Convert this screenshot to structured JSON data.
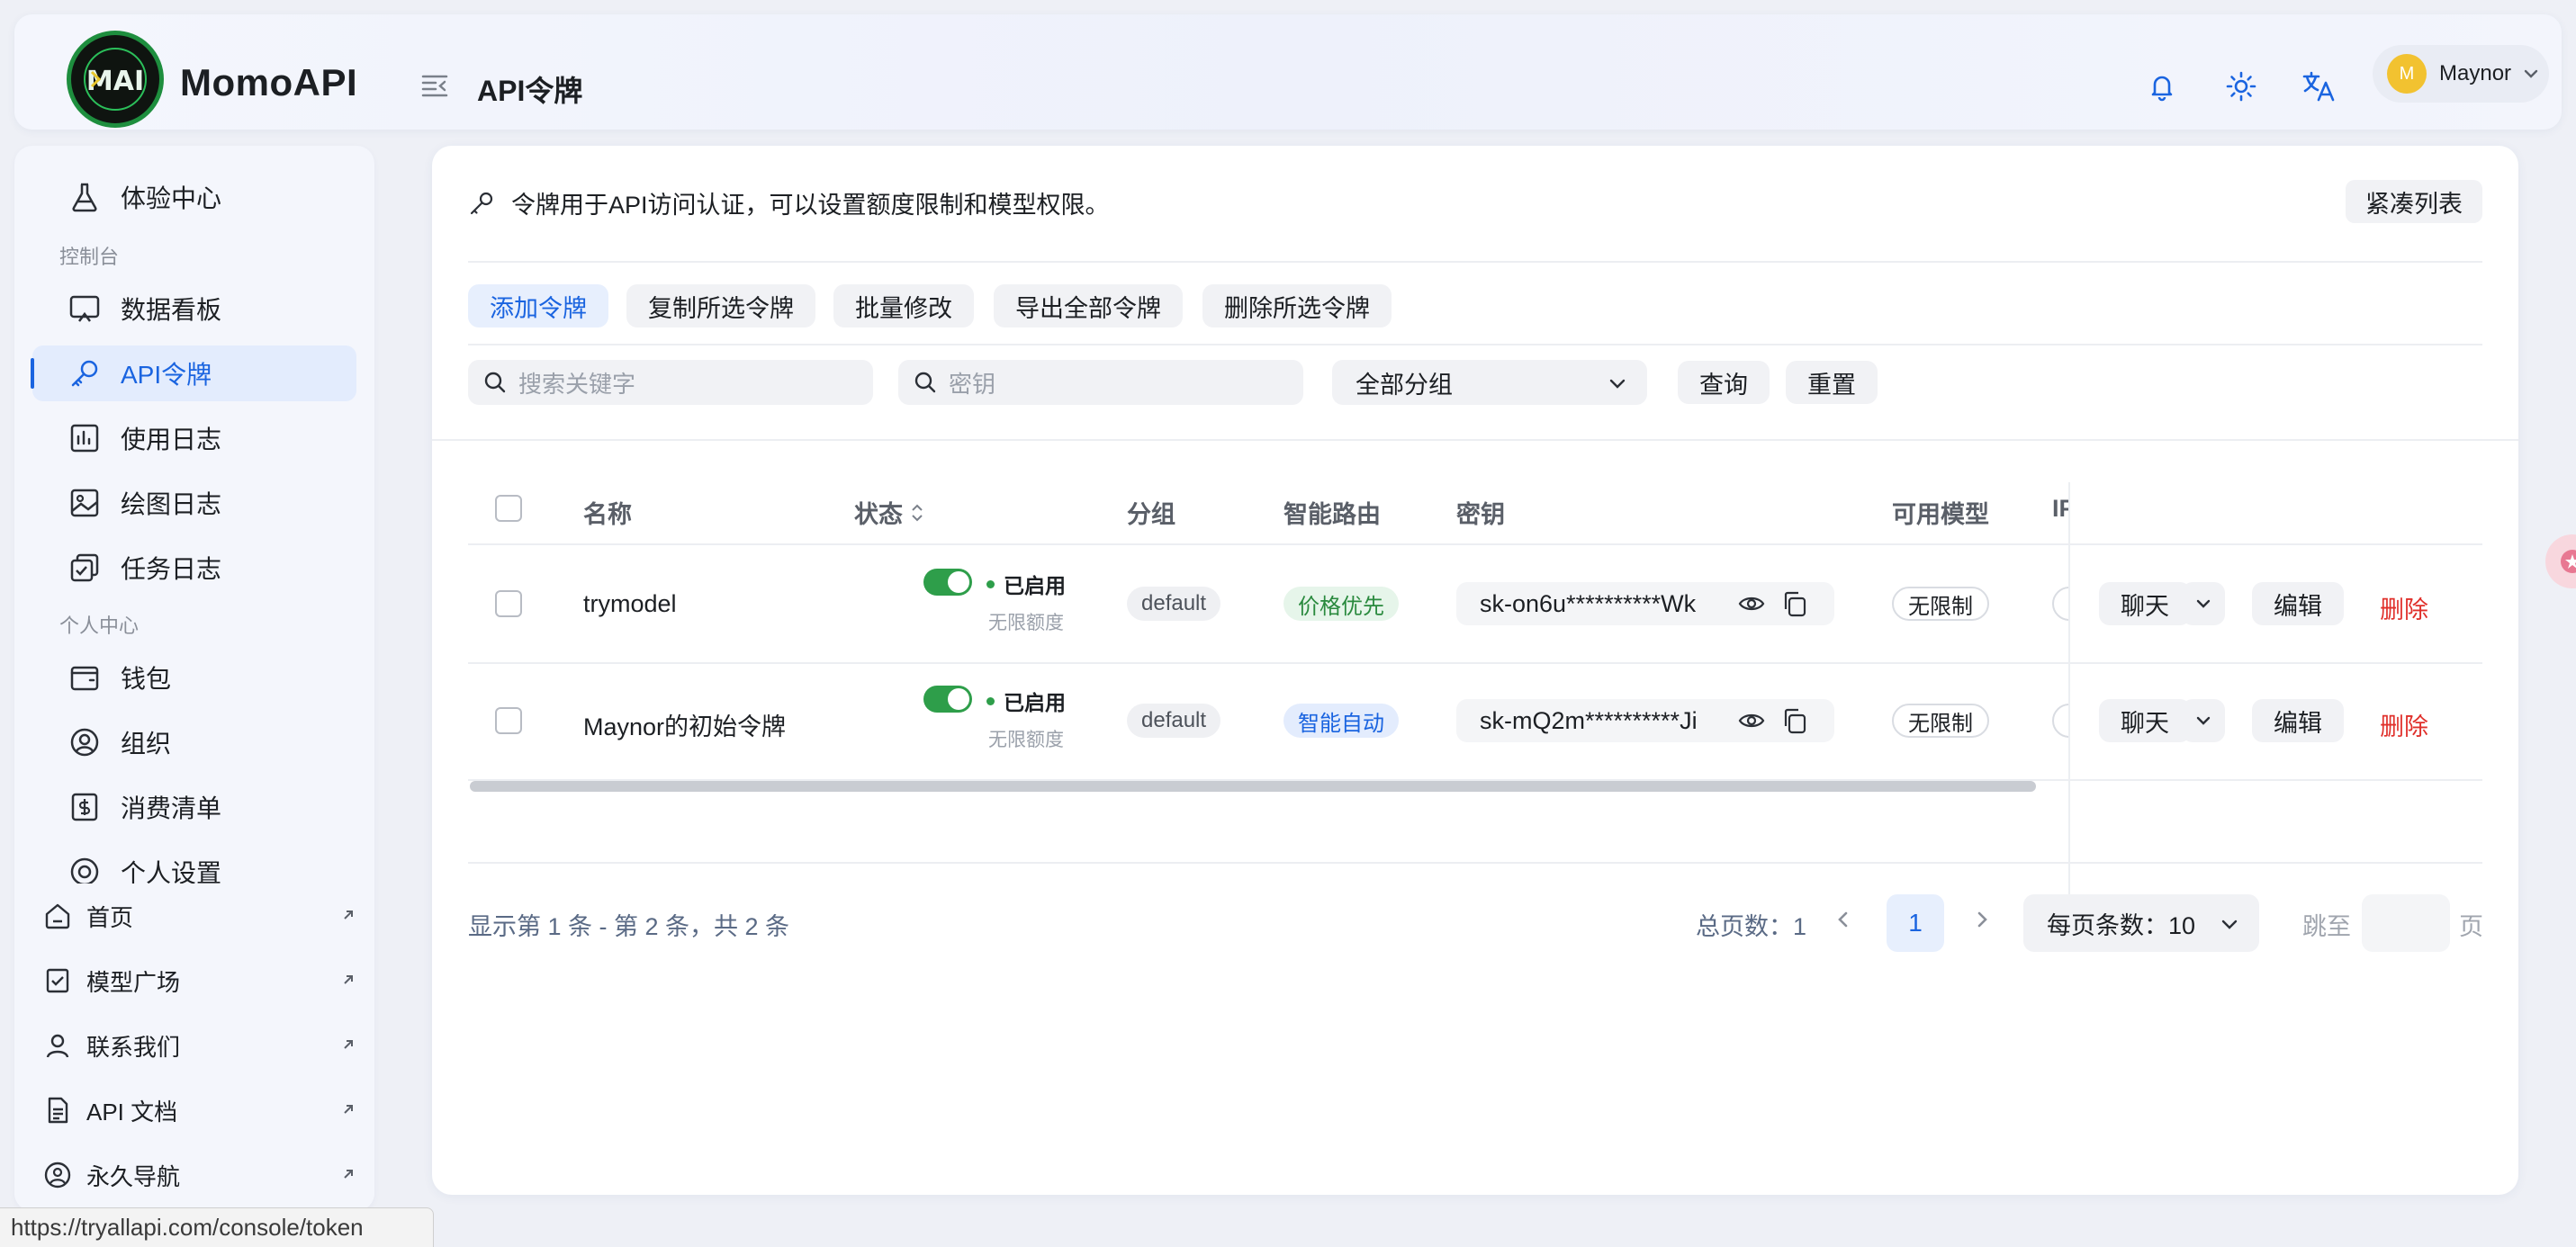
{
  "header": {
    "logo_text": "MomoAPI",
    "page_title": "API令牌",
    "user_initial": "M",
    "user_name": "Maynor"
  },
  "sidebar": {
    "top_items": [
      {
        "label": "体验中心",
        "icon": "flask-icon"
      }
    ],
    "section_console": "控制台",
    "console_items": [
      {
        "label": "数据看板",
        "icon": "dashboard-icon"
      },
      {
        "label": "API令牌",
        "icon": "key-icon",
        "active": true
      },
      {
        "label": "使用日志",
        "icon": "chart-icon"
      },
      {
        "label": "绘图日志",
        "icon": "image-icon"
      },
      {
        "label": "任务日志",
        "icon": "task-icon"
      }
    ],
    "section_personal": "个人中心",
    "personal_items": [
      {
        "label": "钱包",
        "icon": "wallet-icon"
      },
      {
        "label": "组织",
        "icon": "org-icon"
      },
      {
        "label": "消费清单",
        "icon": "bill-icon"
      },
      {
        "label": "个人设置",
        "icon": "user-settings-icon"
      }
    ],
    "links": [
      {
        "label": "首页",
        "icon": "home-icon"
      },
      {
        "label": "模型广场",
        "icon": "market-icon"
      },
      {
        "label": "联系我们",
        "icon": "contact-icon"
      },
      {
        "label": "API 文档",
        "icon": "doc-icon"
      },
      {
        "label": "永久导航",
        "icon": "nav-icon"
      }
    ]
  },
  "main": {
    "info_text": "令牌用于API访问认证，可以设置额度限制和模型权限。",
    "compact_label": "紧凑列表",
    "actions": {
      "add": "添加令牌",
      "copy_selected": "复制所选令牌",
      "batch_edit": "批量修改",
      "export_all": "导出全部令牌",
      "delete_selected": "删除所选令牌"
    },
    "filters": {
      "keyword_placeholder": "搜索关键字",
      "key_placeholder": "密钥",
      "group_value": "全部分组",
      "query": "查询",
      "reset": "重置"
    },
    "table": {
      "columns": [
        "名称",
        "状态",
        "分组",
        "智能路由",
        "密钥",
        "可用模型",
        "IP"
      ],
      "rows": [
        {
          "name": "trymodel",
          "status": "已启用",
          "quota": "无限额度",
          "group": "default",
          "routing": "价格优先",
          "routing_color": "#2a8a3e",
          "key": "sk-on6u**********Wk",
          "models": "无限制",
          "chat": "聊天",
          "edit": "编辑",
          "delete": "删除"
        },
        {
          "name": "Maynor的初始令牌",
          "status": "已启用",
          "quota": "无限额度",
          "group": "default",
          "routing": "智能自动",
          "routing_color": "#1a64e0",
          "key": "sk-mQ2m**********Ji",
          "models": "无限制",
          "chat": "聊天",
          "edit": "编辑",
          "delete": "删除"
        }
      ]
    },
    "pagination": {
      "summary": "显示第 1 条 - 第 2 条，共 2 条",
      "total_pages": "总页数：1",
      "current_page": "1",
      "page_size": "每页条数：10",
      "jump_label": "跳至",
      "jump_suffix": "页"
    }
  },
  "statusbar": {
    "url": "https://tryallapi.com/console/token"
  },
  "colors": {
    "accent": "#1a64e0",
    "danger": "#e0302b",
    "success": "#2e9e4a"
  }
}
